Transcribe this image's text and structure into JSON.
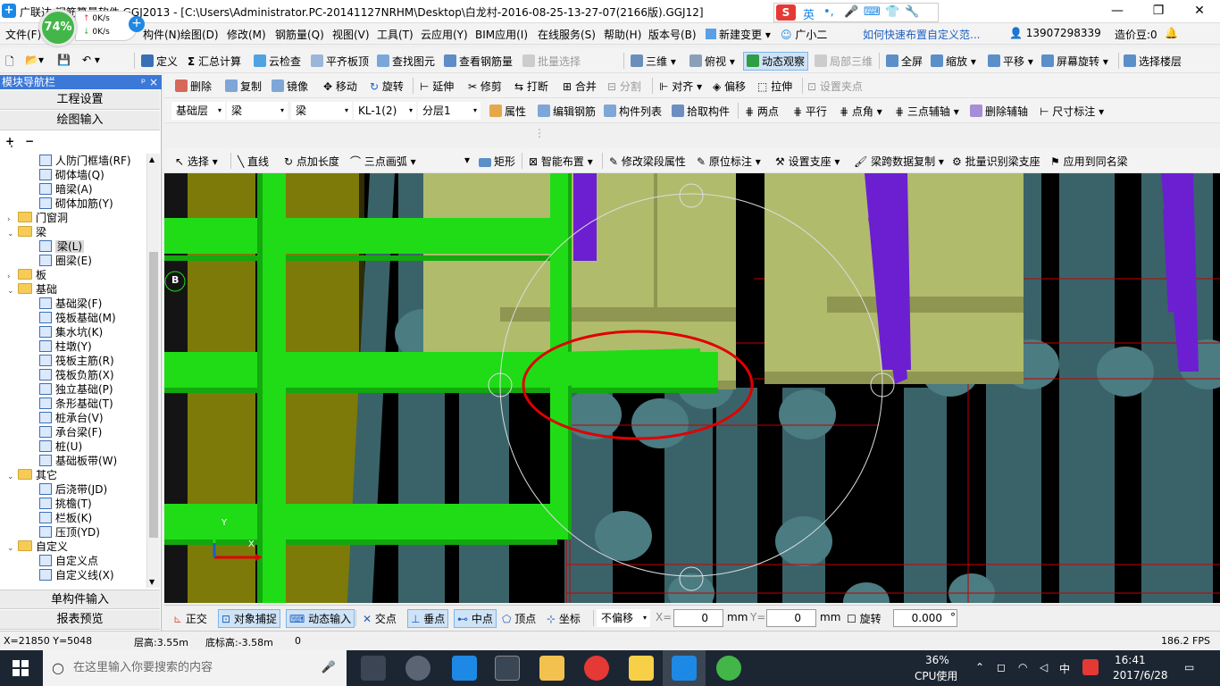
{
  "window": {
    "title": "广联达BIM钢筋算量软件 GGJ2013 - [C:\\Users\\Administrator.PC-20141127NRHM\\Desktop\\白龙村-2016-08-25-13-27-07(2166版).GGJ12]",
    "title_visible": "广联达    钢筋算量软件 GGJ2013 - [C:\\Users\\Administrator.PC-20141127NRHM\\Desktop\\白龙村-2016-08-25-13-27-07(2166版).GGJ12]"
  },
  "speed_widget": {
    "percent": "74%",
    "up": "0K/s",
    "down": "0K/s"
  },
  "ime": {
    "logo": "S",
    "lang": "英"
  },
  "menu": [
    "文件(F)",
    "构件(N)",
    "绘图(D)",
    "修改(M)",
    "钢筋量(Q)",
    "视图(V)",
    "工具(T)",
    "云应用(Y)",
    "BIM应用(I)",
    "在线服务(S)",
    "帮助(H)",
    "版本号(B)",
    "新建变更",
    "广小二",
    "如何快速布置自定义范...",
    "13907298339",
    "造价豆:0"
  ],
  "toolbar1": {
    "items": [
      "定义",
      "汇总计算",
      "云检查",
      "平齐板顶",
      "查找图元",
      "查看钢筋量",
      "批量选择",
      "三维",
      "俯视",
      "动态观察",
      "局部三维",
      "全屏",
      "缩放",
      "平移",
      "屏幕旋转",
      "选择楼层"
    ]
  },
  "toolbar2": {
    "items": [
      "删除",
      "复制",
      "镜像",
      "移动",
      "旋转",
      "延伸",
      "修剪",
      "打断",
      "合并",
      "分割",
      "对齐",
      "偏移",
      "拉伸",
      "设置夹点"
    ]
  },
  "toolbar3": {
    "floor": "基础层",
    "type1": "梁",
    "type2": "梁",
    "component": "KL-1(2)",
    "layer": "分层1",
    "items": [
      "属性",
      "编辑钢筋",
      "构件列表",
      "拾取构件",
      "两点",
      "平行",
      "点角",
      "三点辅轴",
      "删除辅轴",
      "尺寸标注"
    ]
  },
  "toolbar4": {
    "items": [
      "选择",
      "直线",
      "点加长度",
      "三点画弧",
      "矩形",
      "智能布置",
      "修改梁段属性",
      "原位标注",
      "设置支座",
      "梁跨数据复制",
      "批量识别梁支座",
      "应用到同名梁"
    ]
  },
  "left_panel": {
    "header": "模块导航栏",
    "pin": "ᵖ ×",
    "btn_project": "工程设置",
    "btn_draw": "绘图输入",
    "btn_single": "单构件输入",
    "btn_report": "报表预览",
    "tree": [
      {
        "label": "人防门框墙(RF)",
        "level": 2
      },
      {
        "label": "砌体墙(Q)",
        "level": 2
      },
      {
        "label": "暗梁(A)",
        "level": 2
      },
      {
        "label": "砌体加筋(Y)",
        "level": 2
      },
      {
        "label": "门窗洞",
        "level": 1,
        "folder": true,
        "exp": "›"
      },
      {
        "label": "梁",
        "level": 1,
        "folder": true,
        "exp": "⌄"
      },
      {
        "label": "梁(L)",
        "level": 2,
        "selected": true
      },
      {
        "label": "圈梁(E)",
        "level": 2
      },
      {
        "label": "板",
        "level": 1,
        "folder": true,
        "exp": "›"
      },
      {
        "label": "基础",
        "level": 1,
        "folder": true,
        "exp": "⌄"
      },
      {
        "label": "基础梁(F)",
        "level": 2
      },
      {
        "label": "筏板基础(M)",
        "level": 2
      },
      {
        "label": "集水坑(K)",
        "level": 2
      },
      {
        "label": "柱墩(Y)",
        "level": 2
      },
      {
        "label": "筏板主筋(R)",
        "level": 2
      },
      {
        "label": "筏板负筋(X)",
        "level": 2
      },
      {
        "label": "独立基础(P)",
        "level": 2
      },
      {
        "label": "条形基础(T)",
        "level": 2
      },
      {
        "label": "桩承台(V)",
        "level": 2
      },
      {
        "label": "承台梁(F)",
        "level": 2
      },
      {
        "label": "桩(U)",
        "level": 2
      },
      {
        "label": "基础板带(W)",
        "level": 2
      },
      {
        "label": "其它",
        "level": 1,
        "folder": true,
        "exp": "⌄"
      },
      {
        "label": "后浇带(JD)",
        "level": 2
      },
      {
        "label": "挑檐(T)",
        "level": 2
      },
      {
        "label": "栏板(K)",
        "level": 2
      },
      {
        "label": "压顶(YD)",
        "level": 2
      },
      {
        "label": "自定义",
        "level": 1,
        "folder": true,
        "exp": "⌄"
      },
      {
        "label": "自定义点",
        "level": 2
      },
      {
        "label": "自定义线(X)",
        "level": 2
      }
    ]
  },
  "canvas": {
    "axis_label": "B",
    "axis_y": "Y",
    "axis_x": "X"
  },
  "snapbar": {
    "items": [
      "正交",
      "对象捕捉",
      "动态输入",
      "交点",
      "垂点",
      "中点",
      "顶点",
      "坐标"
    ],
    "offset": "不偏移",
    "x_label": "X=",
    "x_value": "0",
    "x_unit": "mm",
    "y_label": "Y=",
    "y_value": "0",
    "y_unit": "mm",
    "rotate_label": "旋转",
    "rotate_value": "0.000",
    "rotate_unit": "°"
  },
  "status": {
    "coords": "X=21850 Y=5048",
    "floor_height": "层高:3.55m",
    "bottom_height": "底标高:-3.58m",
    "count": "0",
    "fps": "186.2 FPS"
  },
  "taskbar": {
    "search_placeholder": "在这里输入你要搜索的内容",
    "cpu_pct": "36%",
    "cpu_label": "CPU使用",
    "lang": "中",
    "time": "16:41",
    "date": "2017/6/28"
  },
  "colors": {
    "beam_green": "#1fdc16",
    "slab": "#b1bb6c",
    "column_teal": "#3a6369",
    "purple_beam": "#6b1fd1",
    "olive_wall": "#7d7a09",
    "highlight_ellipse": "#e00000"
  }
}
